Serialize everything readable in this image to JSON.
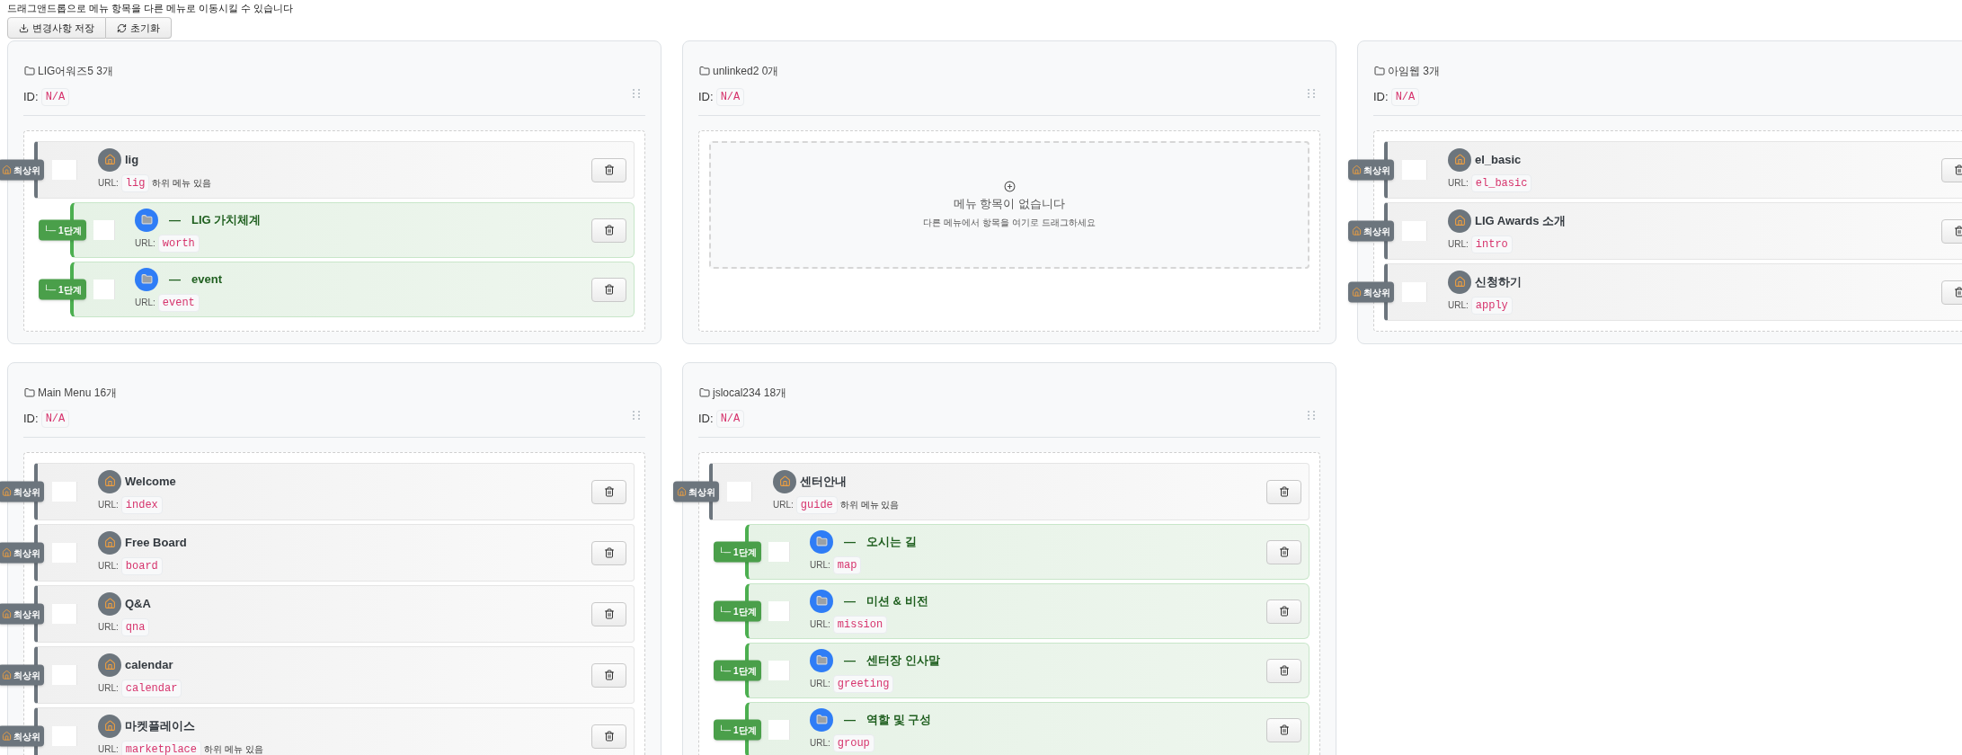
{
  "notice": "드래그앤드롭으로 메뉴 항목을 다른 메뉴로 이동시킬 수 있습니다",
  "buttons": [
    {
      "kind": "save",
      "label": "변경사항 저장"
    },
    {
      "kind": "reset",
      "label": "초기화"
    }
  ],
  "menus": [
    {
      "title": "LIG어워즈5",
      "count": "3개",
      "id_label": "ID:",
      "id": "N/A",
      "items": [
        {
          "badge": "최상위",
          "name": "lig",
          "url_label": "URL:",
          "url": "lig",
          "note": "하위 메뉴 있음",
          "children": [
            {
              "badge": "└─ 1단계",
              "marker": "—",
              "name": "LIG 가치체계",
              "url_label": "URL:",
              "url": "worth"
            },
            {
              "badge": "└─ 1단계",
              "marker": "—",
              "name": "event",
              "url_label": "URL:",
              "url": "event"
            }
          ]
        }
      ]
    },
    {
      "title": "unlinked2",
      "count": "0개",
      "id_label": "ID:",
      "id": "N/A",
      "empty": {
        "title": "메뉴 항목이 없습니다",
        "hint": "다른 메뉴에서 항목을 여기로 드래그하세요"
      }
    },
    {
      "title": "아임웹",
      "count": "3개",
      "id_label": "ID:",
      "id": "N/A",
      "items": [
        {
          "badge": "최상위",
          "name": "el_basic",
          "url_label": "URL:",
          "url": "el_basic"
        },
        {
          "badge": "최상위",
          "name": "LIG Awards 소개",
          "url_label": "URL:",
          "url": "intro"
        },
        {
          "badge": "최상위",
          "name": "신청하기",
          "url_label": "URL:",
          "url": "apply"
        }
      ]
    },
    {
      "title": "Main Menu",
      "count": "16개",
      "id_label": "ID:",
      "id": "N/A",
      "items": [
        {
          "badge": "최상위",
          "name": "Welcome",
          "url_label": "URL:",
          "url": "index"
        },
        {
          "badge": "최상위",
          "name": "Free Board",
          "url_label": "URL:",
          "url": "board"
        },
        {
          "badge": "최상위",
          "name": "Q&A",
          "url_label": "URL:",
          "url": "qna"
        },
        {
          "badge": "최상위",
          "name": "calendar",
          "url_label": "URL:",
          "url": "calendar"
        },
        {
          "badge": "최상위",
          "name": "마켓플레이스",
          "url_label": "URL:",
          "url": "marketplace",
          "note": "하위 메뉴 있음"
        }
      ]
    },
    {
      "title": "jslocal234",
      "count": "18개",
      "id_label": "ID:",
      "id": "N/A",
      "items": [
        {
          "badge": "최상위",
          "name": "센터안내",
          "url_label": "URL:",
          "url": "guide",
          "note": "하위 메뉴 있음",
          "children": [
            {
              "badge": "└─ 1단계",
              "marker": "—",
              "name": "오시는 길",
              "url_label": "URL:",
              "url": "map"
            },
            {
              "badge": "└─ 1단계",
              "marker": "—",
              "name": "미션 & 비전",
              "url_label": "URL:",
              "url": "mission"
            },
            {
              "badge": "└─ 1단계",
              "marker": "—",
              "name": "센터장 인사말",
              "url_label": "URL:",
              "url": "greeting"
            },
            {
              "badge": "└─ 1단계",
              "marker": "—",
              "name": "역할 및 구성",
              "url_label": "URL:",
              "url": "group"
            }
          ]
        }
      ]
    }
  ]
}
